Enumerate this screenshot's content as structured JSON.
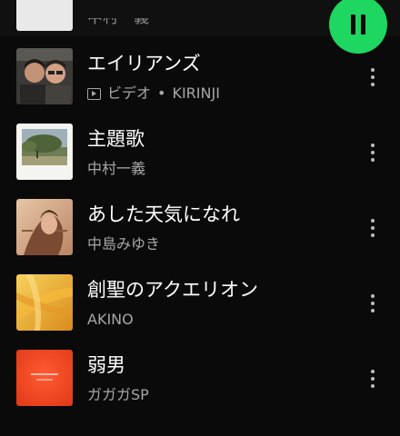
{
  "partial_row": {
    "artist": "中村一義"
  },
  "player": {
    "icon": "pause-icon",
    "accent": "#1ed760"
  },
  "tracks": [
    {
      "title": "エイリアンズ",
      "is_video": true,
      "video_label": "ビデオ",
      "separator": "•",
      "artist": "KIRINJI"
    },
    {
      "title": "主題歌",
      "is_video": false,
      "artist": "中村一義"
    },
    {
      "title": "あした天気になれ",
      "is_video": false,
      "artist": "中島みゆき"
    },
    {
      "title": "創聖のアクエリオン",
      "is_video": false,
      "artist": "AKINO"
    },
    {
      "title": "弱男",
      "is_video": false,
      "artist": "ガガガSP"
    }
  ],
  "colors": {
    "background": "#0a0a0a",
    "title_text": "#ffffff",
    "secondary_text": "#a7a7a7",
    "accent": "#1ed760"
  }
}
